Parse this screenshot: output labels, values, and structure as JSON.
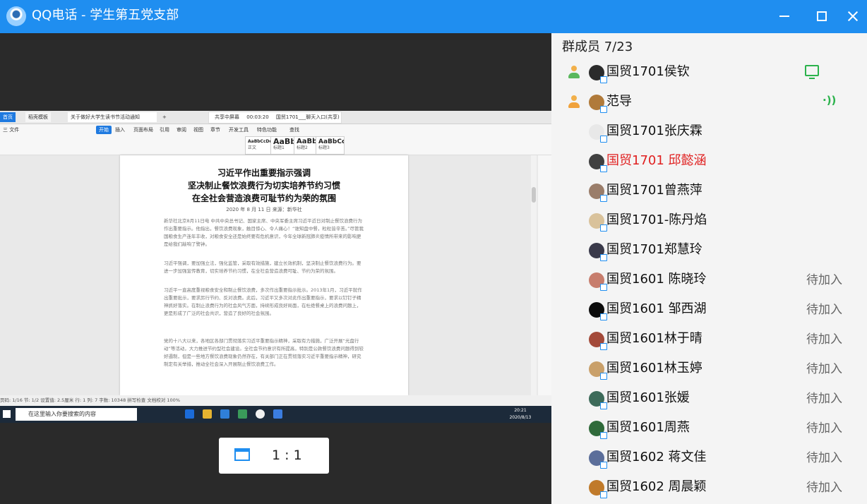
{
  "window": {
    "title": "QQ电话 - 学生第五党支部"
  },
  "shared_screen": {
    "tabs": [
      "首页",
      "稻壳模板",
      "关于做好大学生读书节活动通知",
      "+"
    ],
    "meeting_bar": [
      "共享中屏幕",
      "00:03:20",
      "国贸1701___聊天入口(共享)"
    ],
    "menus": [
      "三 文件",
      "开始",
      "插入",
      "页面布局",
      "引用",
      "审阅",
      "视图",
      "章节",
      "开发工具",
      "特色功能",
      "查找"
    ],
    "styles": [
      {
        "sample": "AaBbCcDd",
        "caption": "正文"
      },
      {
        "sample": "AaBb",
        "caption": "标题1"
      },
      {
        "sample": "AaBbC",
        "caption": "标题2"
      },
      {
        "sample": "AaBbCc",
        "caption": "标题3"
      }
    ],
    "doc": {
      "title_lines": [
        "习近平作出重要指示强调",
        "坚决制止餐饮浪费行为切实培养节约习惯",
        "在全社会营造浪费可耻节约为荣的氛围"
      ],
      "date_line": "2020 年 8 月 11 日    来源：新华社",
      "paragraphs": [
        "新华社北京8月11日电 中共中央总书记、国家主席、中央军委主席习近平近日对制止餐饮浪费行为作出重要指示。他指出，餐饮浪费现象，触目惊心、令人痛心！“谁知盘中餐，粒粒皆辛苦。”尽管我国粮食生产连年丰收，对粮食安全还是始终要有危机意识，今年全球新冠肺炎疫情所带来的影响更是给我们敲响了警钟。",
        "习近平强调，要加强立法，强化监管，采取有效措施，建立长效机制，坚决制止餐饮浪费行为。要进一步加强宣传教育，切实培养节约习惯，在全社会营造浪费可耻、节约为荣的氛围。",
        "习近平一直高度重视粮食安全和制止餐饮浪费，多次作出重要指示批示。2013年1月，习近平就作出重要批示，要求厉行节约、反对浪费。此后，习近平又多次对此作出重要指示，要求以钉钉子精神抓好落实。在制止浪费行为的社会风气方面，持续形成良好局面，在杜绝餐桌上的浪费问题上，更是形成了广泛的社会共识，营造了良好的社会氛围。",
        "党的十八大以来，各地区各部门贯彻落实习近平重要指示精神，采取有力措施，广泛开展“光盘行动”等活动，大力推进节约型社会建设。全社会节约意识有所提高，特别是公款餐饮浪费问题得到较好遏制，但是一些地方餐饮浪费现象仍然存在，有关部门正在贯彻落实习近平重要指示精神，研究制定有关举措，推动全社会深入开展制止餐饮浪费工作。"
      ]
    },
    "status_bar": "页码: 1/16  节: 1/2  设置值: 2.5厘米  行: 1  列: 7  字数: 10348  拼写检查  文档校对    100%",
    "taskbar": {
      "search_placeholder": "在这里输入你要搜索的内容",
      "time": "20:21",
      "date": "2020/8/13"
    }
  },
  "ratio_button": {
    "label": "1 : 1"
  },
  "panel": {
    "header": "群成员 7/23",
    "members": [
      {
        "name": "国贸1701侯钦",
        "status": "",
        "role_icon": "host-green",
        "indicator": "screen-share-icon",
        "avatar_color": "#2b2b2b",
        "name_color": "#111111"
      },
      {
        "name": "范导",
        "status": "",
        "role_icon": "host-orange",
        "indicator": "voice-icon",
        "avatar_color": "#b07a3a",
        "name_color": "#111111"
      },
      {
        "name": "国贸1701张庆霖",
        "status": "",
        "role_icon": "",
        "indicator": "",
        "avatar_color": "#e8e8e8",
        "name_color": "#111111"
      },
      {
        "name": "国贸1701 邱懿涵",
        "status": "",
        "role_icon": "",
        "indicator": "",
        "avatar_color": "#404040",
        "name_color": "#e02020"
      },
      {
        "name": "国贸1701曾燕萍",
        "status": "",
        "role_icon": "",
        "indicator": "",
        "avatar_color": "#9a7d6a",
        "name_color": "#111111"
      },
      {
        "name": "国贸1701-陈丹焰",
        "status": "",
        "role_icon": "",
        "indicator": "",
        "avatar_color": "#d9c29b",
        "name_color": "#111111"
      },
      {
        "name": "国贸1701郑慧玲",
        "status": "",
        "role_icon": "",
        "indicator": "",
        "avatar_color": "#3a3a4a",
        "name_color": "#111111"
      },
      {
        "name": "国贸1601 陈晓玲",
        "status": "待加入",
        "role_icon": "",
        "indicator": "",
        "avatar_color": "#c77d6d",
        "name_color": "#111111"
      },
      {
        "name": "国贸1601 邹西湖",
        "status": "待加入",
        "role_icon": "",
        "indicator": "",
        "avatar_color": "#0d0d0d",
        "name_color": "#111111"
      },
      {
        "name": "国贸1601林于晴",
        "status": "待加入",
        "role_icon": "",
        "indicator": "",
        "avatar_color": "#a34a3a",
        "name_color": "#111111"
      },
      {
        "name": "国贸1601林玉婷",
        "status": "待加入",
        "role_icon": "",
        "indicator": "",
        "avatar_color": "#c9a06a",
        "name_color": "#111111"
      },
      {
        "name": "国贸1601张媛",
        "status": "待加入",
        "role_icon": "",
        "indicator": "",
        "avatar_color": "#3d6b5a",
        "name_color": "#111111"
      },
      {
        "name": "国贸1601周燕",
        "status": "待加入",
        "role_icon": "",
        "indicator": "",
        "avatar_color": "#2f6a3a",
        "name_color": "#111111"
      },
      {
        "name": "国贸1602  蒋文佳",
        "status": "待加入",
        "role_icon": "",
        "indicator": "",
        "avatar_color": "#5b6e9a",
        "name_color": "#111111"
      },
      {
        "name": "国贸1602 周晨颖",
        "status": "待加入",
        "role_icon": "",
        "indicator": "",
        "avatar_color": "#c07a2a",
        "name_color": "#111111"
      }
    ]
  }
}
